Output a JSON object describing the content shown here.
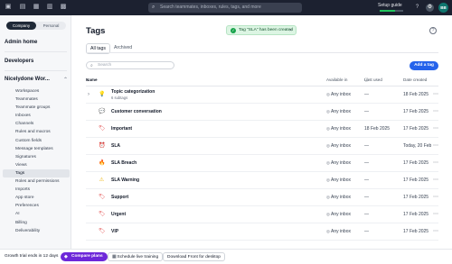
{
  "topbar": {
    "search_placeholder": "Search teammates, inboxes, rules, tags, and more",
    "setup_label": "Setup guide",
    "setup_progress": 0.65,
    "avatar_initials": "BB"
  },
  "sidebar": {
    "segment": {
      "company": "Company",
      "personal": "Personal"
    },
    "admin_home": "Admin home",
    "developers": "Developers",
    "workspace": "Nicelydone Wor...",
    "items": [
      {
        "label": "Workspaces"
      },
      {
        "label": "Teammates"
      },
      {
        "label": "Teammate groups"
      },
      {
        "label": "Inboxes"
      },
      {
        "label": "Channels"
      },
      {
        "label": "Rules and macros"
      },
      {
        "label": "Custom fields"
      },
      {
        "label": "Message templates"
      },
      {
        "label": "Signatures"
      },
      {
        "label": "Views"
      },
      {
        "label": "Tags"
      },
      {
        "label": "Roles and permissions"
      },
      {
        "label": "Imports"
      },
      {
        "label": "App store"
      },
      {
        "label": "Preferences"
      },
      {
        "label": "AI"
      },
      {
        "label": "Billing"
      },
      {
        "label": "Deliverability"
      }
    ],
    "active_index": 10
  },
  "main": {
    "title": "Tags",
    "toast": "Tag \"SLA\" has been created",
    "tabs": [
      {
        "label": "All tags"
      },
      {
        "label": "Archived"
      }
    ],
    "search_placeholder": "Search",
    "add_button": "Add a tag",
    "columns": {
      "name": "Name",
      "available": "Available in",
      "last_used": "Last used",
      "created": "Date created"
    }
  },
  "tags": [
    {
      "name": "Topic categorization",
      "sub": "6 subtags",
      "icon": "lightbulb-icon",
      "glyph": "💡",
      "color": "#8a6d00",
      "available": "Any inbox",
      "last_used": "—",
      "created": "18 Feb 2025"
    },
    {
      "name": "Customer conversation",
      "sub": "",
      "icon": "chat-icon",
      "glyph": "💬",
      "color": "#d97706",
      "available": "Any inbox",
      "last_used": "—",
      "created": "17 Feb 2025"
    },
    {
      "name": "Important",
      "sub": "",
      "icon": "tag-icon",
      "glyph": "🏷",
      "color": "#dc2626",
      "available": "Any inbox",
      "last_used": "18 Feb 2025",
      "created": "17 Feb 2025"
    },
    {
      "name": "SLA",
      "sub": "",
      "icon": "clock-icon",
      "glyph": "⏰",
      "color": "#ea580c",
      "available": "Any inbox",
      "last_used": "—",
      "created": "Today, 20 Feb"
    },
    {
      "name": "SLA Breach",
      "sub": "",
      "icon": "fire-icon",
      "glyph": "🔥",
      "color": "#ea580c",
      "available": "Any inbox",
      "last_used": "—",
      "created": "17 Feb 2025"
    },
    {
      "name": "SLA Warning",
      "sub": "",
      "icon": "warning-icon",
      "glyph": "⚠",
      "color": "#eab308",
      "available": "Any inbox",
      "last_used": "—",
      "created": "17 Feb 2025"
    },
    {
      "name": "Support",
      "sub": "",
      "icon": "tag-icon",
      "glyph": "🏷",
      "color": "#dc2626",
      "available": "Any inbox",
      "last_used": "—",
      "created": "17 Feb 2025"
    },
    {
      "name": "Urgent",
      "sub": "",
      "icon": "tag-icon",
      "glyph": "🏷",
      "color": "#dc2626",
      "available": "Any inbox",
      "last_used": "—",
      "created": "17 Feb 2025"
    },
    {
      "name": "VIP",
      "sub": "",
      "icon": "tag-icon",
      "glyph": "🏷",
      "color": "#dc2626",
      "available": "Any inbox",
      "last_used": "—",
      "created": "17 Feb 2025"
    }
  ],
  "footer": {
    "trial": "Growth trial ends in 12 days",
    "compare": "Compare plans",
    "schedule": "Schedule live training",
    "download": "Download Front for desktop"
  }
}
